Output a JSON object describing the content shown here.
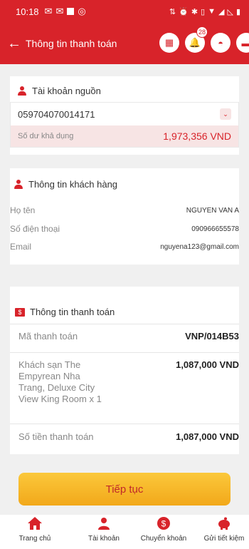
{
  "status_bar": {
    "time": "10:18"
  },
  "appbar": {
    "title": "Thông tin thanh toán",
    "notification_count": "28"
  },
  "source_account": {
    "title": "Tài khoản nguồn",
    "account_number": "059704070014171",
    "balance_label": "Số dư khả dụng",
    "balance_value": "1,973,356 VND"
  },
  "customer": {
    "title": "Thông tin khách hàng",
    "name_label": "Họ tên",
    "name_value": "NGUYEN VAN A",
    "phone_label": "Số điện thoại",
    "phone_value": "090966655578",
    "email_label": "Email",
    "email_value": "nguyena123@gmail.com"
  },
  "payment": {
    "title": "Thông tin thanh toán",
    "code_label": "Mã thanh toán",
    "code_value": "VNP/014B53",
    "item_label": "Khách sạn The Empyrean Nha Trang, Deluxe City View King Room x 1",
    "item_value": "1,087,000 VND",
    "total_label": "Số tiền thanh toán",
    "total_value": "1,087,000 VND"
  },
  "continue_label": "Tiếp tục",
  "nav": [
    {
      "label": "Trang chủ"
    },
    {
      "label": "Tài khoản"
    },
    {
      "label": "Chuyển khoản"
    },
    {
      "label": "Gửi tiết kiệm"
    }
  ],
  "colors": {
    "brand": "#d8232a",
    "button": "#f9b42a",
    "balance_bg": "#f7e4e4"
  }
}
